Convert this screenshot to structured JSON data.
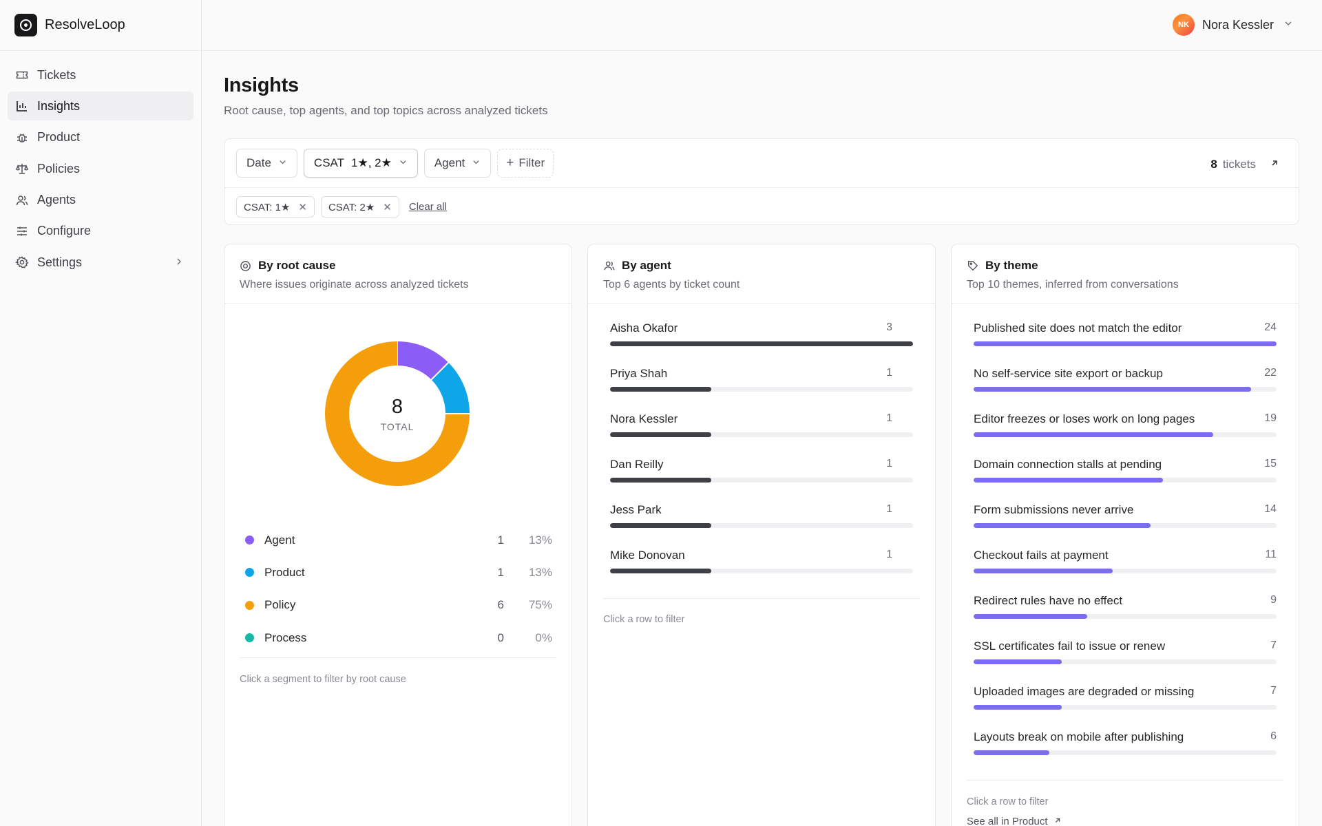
{
  "app": {
    "name": "ResolveLoop"
  },
  "sidebar": {
    "items": [
      {
        "label": "Tickets",
        "icon": "ticket-icon",
        "active": false
      },
      {
        "label": "Insights",
        "icon": "bar-chart-icon",
        "active": true
      },
      {
        "label": "Product",
        "icon": "bug-icon",
        "active": false
      },
      {
        "label": "Policies",
        "icon": "scale-icon",
        "active": false
      },
      {
        "label": "Agents",
        "icon": "users-icon",
        "active": false
      },
      {
        "label": "Configure",
        "icon": "sliders-icon",
        "active": false
      },
      {
        "label": "Settings",
        "icon": "gear-icon",
        "active": false
      }
    ]
  },
  "user": {
    "initials": "NK",
    "name": "Nora Kessler"
  },
  "page": {
    "title": "Insights",
    "subtitle": "Root cause, top agents, and top topics across analyzed tickets"
  },
  "filters": {
    "date_label": "Date",
    "csat_label": "CSAT",
    "csat_value": "1★, 2★",
    "agent_label": "Agent",
    "add_filter_label": "Filter",
    "ticket_count": "8",
    "ticket_count_unit": "tickets",
    "chips": [
      "CSAT: 1★",
      "CSAT: 2★"
    ],
    "clear_all_label": "Clear all"
  },
  "root_cause": {
    "title": "By root cause",
    "subtitle": "Where issues originate across analyzed tickets",
    "total": "8",
    "total_label": "TOTAL",
    "hint": "Click a segment to filter by root cause"
  },
  "by_agent": {
    "title": "By agent",
    "subtitle": "Top 6 agents by ticket count",
    "hint": "Click a row to filter"
  },
  "by_theme": {
    "title": "By theme",
    "subtitle": "Top 10 themes, inferred from conversations",
    "hint": "Click a row to filter",
    "see_all_label": "See all in Product"
  },
  "chart_data": [
    {
      "type": "pie",
      "title": "By root cause",
      "categories": [
        "Agent",
        "Product",
        "Policy",
        "Process"
      ],
      "values": [
        1,
        1,
        6,
        0
      ],
      "percent_labels": [
        "13%",
        "13%",
        "75%",
        "0%"
      ],
      "colors": [
        "#8b5cf6",
        "#0ea5e9",
        "#f59e0b",
        "#14b8a6"
      ]
    },
    {
      "type": "bar",
      "title": "By agent",
      "categories": [
        "Aisha Okafor",
        "Priya Shah",
        "Nora Kessler",
        "Dan Reilly",
        "Jess Park",
        "Mike Donovan"
      ],
      "values": [
        3,
        1,
        1,
        1,
        1,
        1
      ],
      "color": "#3f3f46"
    },
    {
      "type": "bar",
      "title": "By theme",
      "categories": [
        "Published site does not match the editor",
        "No self-service site export or backup",
        "Editor freezes or loses work on long pages",
        "Domain connection stalls at pending",
        "Form submissions never arrive",
        "Checkout fails at payment",
        "Redirect rules have no effect",
        "SSL certificates fail to issue or renew",
        "Uploaded images are degraded or missing",
        "Layouts break on mobile after publishing"
      ],
      "values": [
        24,
        22,
        19,
        15,
        14,
        11,
        9,
        7,
        7,
        6
      ],
      "color": "#7c6cf0"
    }
  ]
}
